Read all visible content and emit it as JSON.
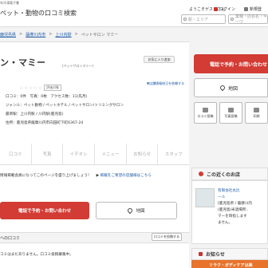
{
  "header": {
    "small": "年冷凍電子書",
    "title": "ペット・動物の口コミ検索",
    "welcome": "ようこそゲストさん",
    "login": "ログイン",
    "register": "新規登",
    "search_area_placeholder": "駅・エリア",
    "search_kw_placeholder": "業種・店名名・キーワ"
  },
  "breadcrumb": [
    "鹿児島県",
    "薩摩川内市",
    "上川内駅",
    "ペットサロン マミー"
  ],
  "shop": {
    "title": "ン・マミー",
    "title_kana": "(ペットサロンマミー)",
    "fav_button": "お気に入り追加",
    "stars": "☆☆☆☆☆",
    "eval_tag": "評価対象",
    "report": "▼店舗情報修正を依頼する",
    "info": [
      "口コミ：0件　写真：0枚　アクセス数：11(先月)",
      "ジャンル：ペット動物 / ペットホテル / ペットサロン/トリミングサロン",
      "最寄駅：上川内駅 / 川内駅(鹿児島)",
      "住所：鹿児島県薩摩川内市向田町下町6367-24"
    ]
  },
  "tabs": [
    "口コミ",
    "写真",
    "イチオシ",
    "メニュー",
    "お知らせ",
    "スタッフ"
  ],
  "notice": {
    "text": "情報掲載会員になってこのページを盛り上げましょう！",
    "link": "掲載をご希望の店舗様はこちら"
  },
  "cta": {
    "phone": "電話で予約・お問い合わせ",
    "map": "地図"
  },
  "reviews": {
    "heading": "への口コミ",
    "post_button": "口コミを投稿する",
    "empty": "コミはまだありません。口コミ投稿募集中。"
  },
  "sidebar": {
    "phone": "電話で予約・お問い合わせ",
    "map": "地図",
    "mini_buttons": [
      "口コミ投稿",
      "写真投稿",
      "印刷"
    ],
    "near_heading": "この近くのお店",
    "near_shop_lines": [
      "有限会社丸比",
      "ール",
      "[鹿児島県 / 薩摩川内",
      "(鹿児島/米酒場所..",
      "マーを目指します",
      "ません。"
    ],
    "notice_heading": "お知らせ",
    "banner": "リラク・ボディケアは美"
  },
  "colors": {
    "accent_red": "#d23c34",
    "link_blue": "#1a58a8",
    "banner_orange": "#e8732b"
  }
}
